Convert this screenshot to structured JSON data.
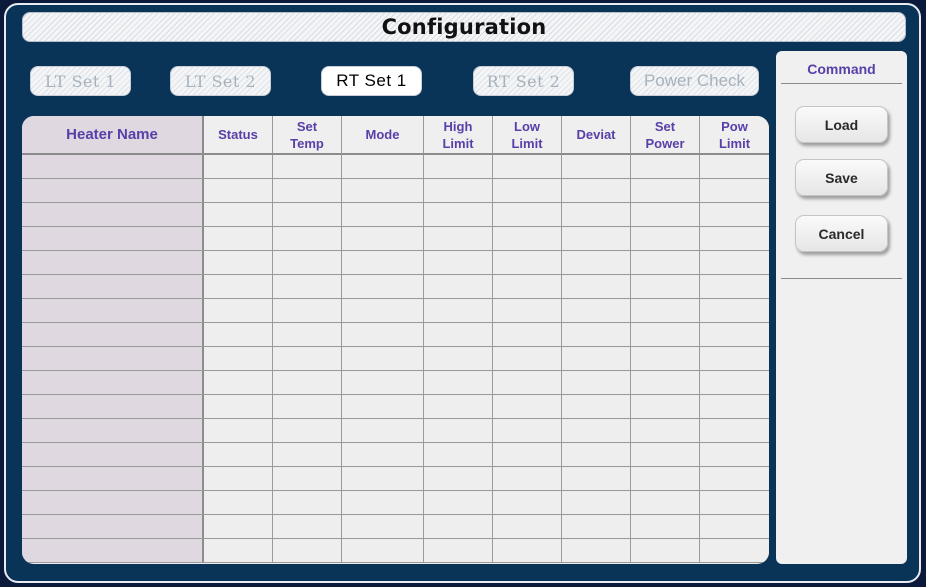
{
  "window": {
    "title": "Configuration"
  },
  "tabs": [
    {
      "label": "LT  Set 1",
      "active": false
    },
    {
      "label": "LT  Set 2",
      "active": false
    },
    {
      "label": "RT  Set 1",
      "active": true
    },
    {
      "label": "RT  Set 2",
      "active": false
    },
    {
      "label": "Power Check",
      "active": false
    }
  ],
  "table": {
    "columns": [
      {
        "label": "Heater Name"
      },
      {
        "label": "Status"
      },
      {
        "label": "Set\nTemp"
      },
      {
        "label": "Mode"
      },
      {
        "label": "High\nLimit"
      },
      {
        "label": "Low\nLimit"
      },
      {
        "label": "Deviat"
      },
      {
        "label": "Set\nPower"
      },
      {
        "label": "Pow\nLimit"
      }
    ],
    "rows": [
      [
        "",
        "",
        "",
        "",
        "",
        "",
        "",
        "",
        ""
      ],
      [
        "",
        "",
        "",
        "",
        "",
        "",
        "",
        "",
        ""
      ],
      [
        "",
        "",
        "",
        "",
        "",
        "",
        "",
        "",
        ""
      ],
      [
        "",
        "",
        "",
        "",
        "",
        "",
        "",
        "",
        ""
      ],
      [
        "",
        "",
        "",
        "",
        "",
        "",
        "",
        "",
        ""
      ],
      [
        "",
        "",
        "",
        "",
        "",
        "",
        "",
        "",
        ""
      ],
      [
        "",
        "",
        "",
        "",
        "",
        "",
        "",
        "",
        ""
      ],
      [
        "",
        "",
        "",
        "",
        "",
        "",
        "",
        "",
        ""
      ],
      [
        "",
        "",
        "",
        "",
        "",
        "",
        "",
        "",
        ""
      ],
      [
        "",
        "",
        "",
        "",
        "",
        "",
        "",
        "",
        ""
      ],
      [
        "",
        "",
        "",
        "",
        "",
        "",
        "",
        "",
        ""
      ],
      [
        "",
        "",
        "",
        "",
        "",
        "",
        "",
        "",
        ""
      ],
      [
        "",
        "",
        "",
        "",
        "",
        "",
        "",
        "",
        ""
      ],
      [
        "",
        "",
        "",
        "",
        "",
        "",
        "",
        "",
        ""
      ],
      [
        "",
        "",
        "",
        "",
        "",
        "",
        "",
        "",
        ""
      ],
      [
        "",
        "",
        "",
        "",
        "",
        "",
        "",
        "",
        ""
      ],
      [
        "",
        "",
        "",
        "",
        "",
        "",
        "",
        "",
        ""
      ]
    ]
  },
  "command_panel": {
    "title": "Command",
    "buttons": [
      {
        "label": "Load"
      },
      {
        "label": "Save"
      },
      {
        "label": "Cancel"
      }
    ]
  }
}
